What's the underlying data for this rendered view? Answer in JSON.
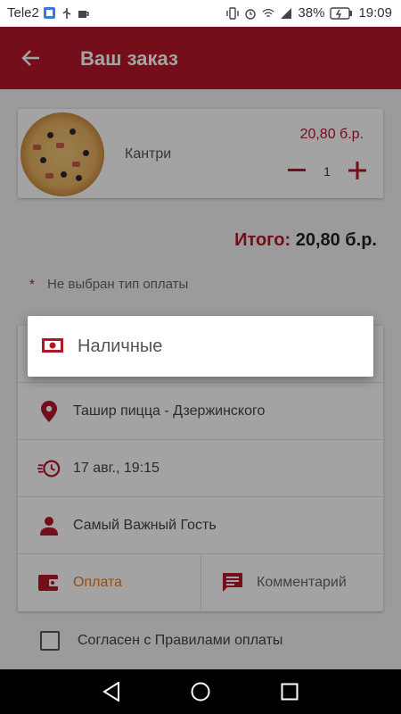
{
  "status_bar": {
    "carrier": "Tele2",
    "battery_percent": "38%",
    "time": "19:09",
    "icons": [
      "app-badge-icon",
      "usb-icon",
      "coffee-icon",
      "vibrate-icon",
      "alarm-icon",
      "wifi-icon",
      "signal-icon",
      "battery-charging-icon"
    ]
  },
  "app_bar": {
    "title": "Ваш заказ",
    "back_icon": "arrow-back-icon"
  },
  "order": {
    "item": {
      "name": "Кантри",
      "price": "20,80 б.р.",
      "quantity": "1"
    },
    "total_label": "Итого:",
    "total_value": "20,80 б.р."
  },
  "payment_warning": {
    "asterisk": "*",
    "text": "Не выбран тип оплаты"
  },
  "details": {
    "restaurant": "Ташир пицца - Дзержинского",
    "time": "17 авг., 19:15",
    "guest": "Самый Важный Гость",
    "payment_label": "Оплата",
    "comment_label": "Комментарий"
  },
  "agreement": {
    "label": "Согласен с Правилами оплаты",
    "checked": false
  },
  "popup": {
    "option": "Наличные"
  },
  "colors": {
    "primary": "#b5172a",
    "accent_orange": "#e07b2a"
  }
}
